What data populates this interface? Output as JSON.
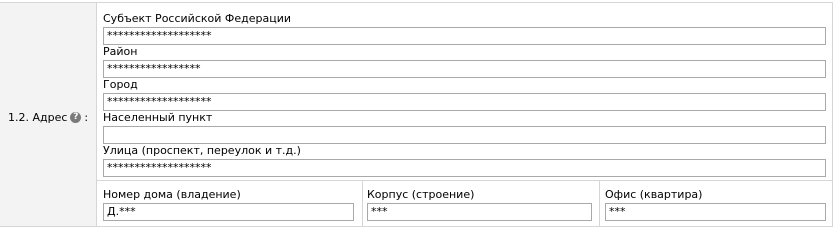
{
  "row_label": "1.2. Адрес",
  "row_colon": ":",
  "fields": [
    {
      "label": "Субъект Российской Федерации",
      "value": "*******************"
    },
    {
      "label": "Район",
      "value": "  *****************"
    },
    {
      "label": "Город",
      "value": "*******************"
    },
    {
      "label": "Населенный пункт",
      "value": ""
    },
    {
      "label": "Улица (проспект, переулок и т.д.)",
      "value": "*******************"
    }
  ],
  "bottom": [
    {
      "label": "Номер дома (владение)",
      "value": "Д.***"
    },
    {
      "label": "Корпус (строение)",
      "value": "***"
    },
    {
      "label": "Офис (квартира)",
      "value": "***"
    }
  ],
  "icons": {
    "help": "question-mark-icon"
  }
}
